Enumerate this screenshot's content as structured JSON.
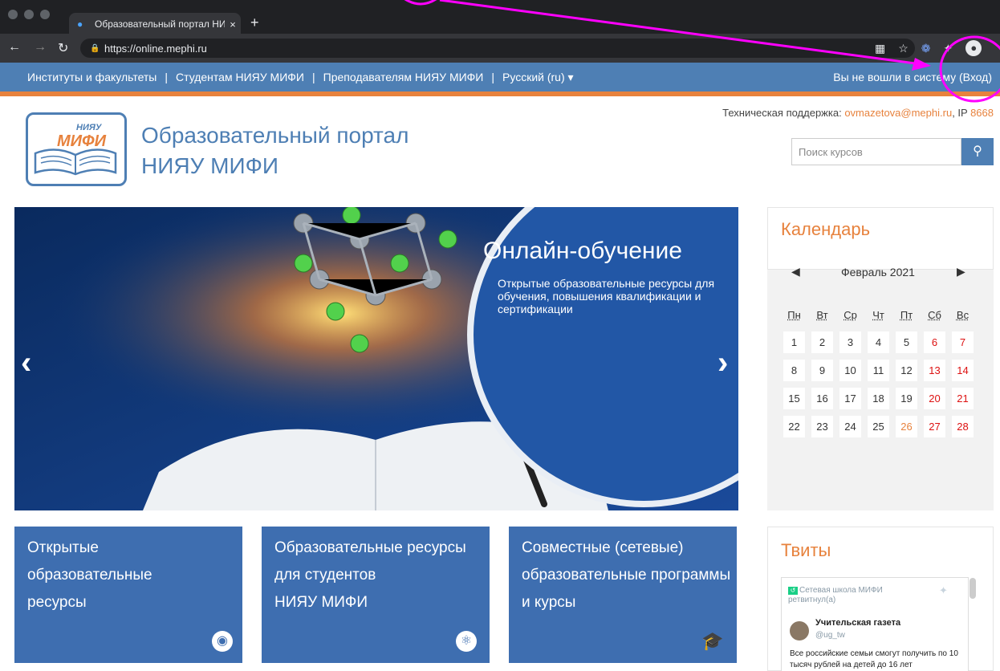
{
  "browser": {
    "tab_title": "Образовательный портал НИ",
    "tab_close": "×",
    "new_tab": "+",
    "url": "https://online.mephi.ru"
  },
  "sitenav": {
    "items": [
      "Институты и факультеты",
      "Студентам НИЯУ МИФИ",
      "Преподавателям НИЯУ МИФИ",
      "Русский (ru) ▾"
    ],
    "separator": "|",
    "login_text": "Вы не вошли в систему (Вход)"
  },
  "header": {
    "logo_top": "НИЯУ",
    "logo_main": "МИФИ",
    "title_line1": "Образовательный портал",
    "title_line2": "НИЯУ МИФИ",
    "support_label": "Техническая поддержка: ",
    "support_email": "ovmazetova@mephi.ru",
    "support_ip_label": ", IP ",
    "support_ip": "8668",
    "search_placeholder": "Поиск курсов"
  },
  "slider": {
    "title": "Онлайн-обучение",
    "subtitle": "Открытые образовательные ресурсы для обучения, повышения квалификации и сертификации",
    "prev": "‹",
    "next": "›"
  },
  "calendar": {
    "title": "Календарь",
    "month": "Февраль 2021",
    "prev": "◀",
    "next": "▶",
    "weekdays": [
      "Пн",
      "Вт",
      "Ср",
      "Чт",
      "Пт",
      "Сб",
      "Вс"
    ],
    "weeks": [
      [
        "1",
        "2",
        "3",
        "4",
        "5",
        "6",
        "7"
      ],
      [
        "8",
        "9",
        "10",
        "11",
        "12",
        "13",
        "14"
      ],
      [
        "15",
        "16",
        "17",
        "18",
        "19",
        "20",
        "21"
      ],
      [
        "22",
        "23",
        "24",
        "25",
        "26",
        "27",
        "28"
      ]
    ],
    "today": "26",
    "weekend_color": "#dd1111",
    "today_color": "#e7823d"
  },
  "tiles": [
    {
      "lines": [
        "Открытые",
        "образовательные",
        "ресурсы"
      ],
      "icon": "globe-icon"
    },
    {
      "lines": [
        "Образовательные ресурсы",
        "для студентов",
        "НИЯУ МИФИ"
      ],
      "icon": "atom-icon"
    },
    {
      "lines": [
        "Совместные (сетевые)",
        "образовательные программы",
        "и курсы"
      ],
      "icon": "graduation-cap-icon"
    }
  ],
  "tweets": {
    "title": "Твиты",
    "retweet_by": "Сетевая школа МИФИ ретвитнул(а)",
    "user": "Учительская газета",
    "handle": "@ug_tw",
    "text": "Все российские семьи смогут получить по 10 тысяч рублей на детей до 16 лет"
  },
  "colors": {
    "accent": "#e7823d",
    "brand": "#4e7fb4",
    "tile": "#3e6eb0",
    "annotation": "#ff00ff"
  }
}
